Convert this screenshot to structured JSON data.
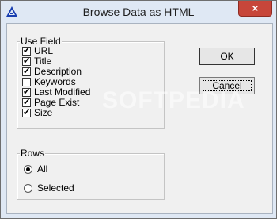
{
  "window": {
    "title": "Browse Data as HTML",
    "close_label": "×"
  },
  "use_field": {
    "legend": "Use Field",
    "items": [
      {
        "label": "URL",
        "checked": true
      },
      {
        "label": "Title",
        "checked": true
      },
      {
        "label": "Description",
        "checked": true
      },
      {
        "label": "Keywords",
        "checked": false
      },
      {
        "label": "Last Modified",
        "checked": true
      },
      {
        "label": "Page Exist",
        "checked": true
      },
      {
        "label": "Size",
        "checked": true
      }
    ]
  },
  "rows": {
    "legend": "Rows",
    "options": [
      {
        "label": "All",
        "selected": true
      },
      {
        "label": "Selected",
        "selected": false
      }
    ]
  },
  "buttons": {
    "ok": "OK",
    "cancel": "Cancel"
  },
  "watermark": "SOFTPEDIA"
}
